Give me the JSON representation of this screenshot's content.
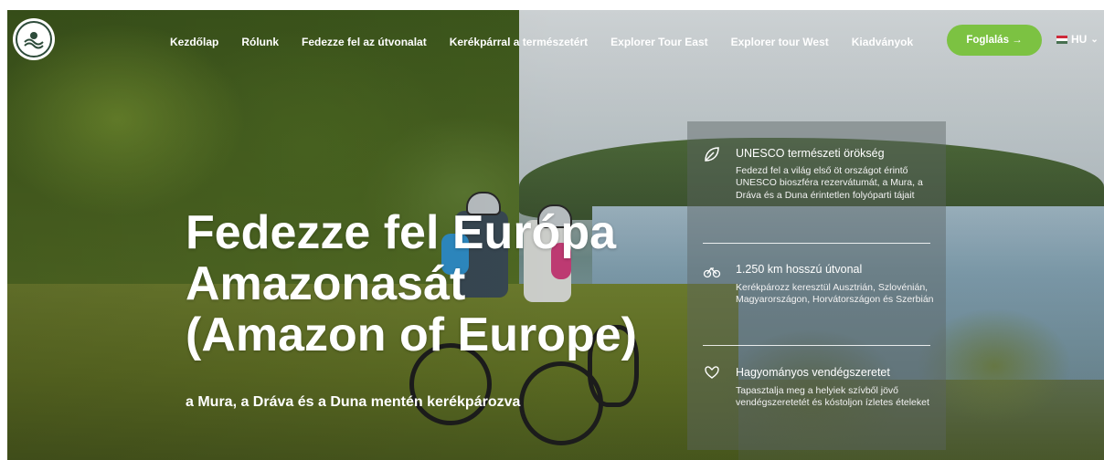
{
  "nav": {
    "logo_label": "",
    "items": [
      {
        "label": "Kezdőlap"
      },
      {
        "label": "Rólunk"
      },
      {
        "label": "Fedezze fel az útvonalat"
      },
      {
        "label": "Kerékpárral a természetért"
      },
      {
        "label": "Explorer Tour East"
      },
      {
        "label": "Explorer tour West"
      },
      {
        "label": "Kiadványok"
      }
    ],
    "cta_label": "Foglalás →",
    "language": "HU",
    "accent_color": "#7cc242"
  },
  "hero": {
    "headline_lines": [
      "Fedezze fel Európa",
      "Amazonasát",
      "(Amazon of Europe)"
    ],
    "subheadline": "a Mura, a Dráva és a Duna mentén kerékpározva"
  },
  "features": [
    {
      "icon": "leaf-icon",
      "title": "UNESCO természeti örökség",
      "description": "Fedezd fel a világ első öt országot érintő UNESCO bioszféra rezervátumát, a Mura, a Dráva és a Duna érintetlen folyóparti tájait"
    },
    {
      "icon": "bicycle-icon",
      "title": "1.250 km hosszú útvonal",
      "description": "Kerékpározz keresztül Ausztrián, Szlovénián, Magyarországon, Horvátországon és Szerbián"
    },
    {
      "icon": "heart-hands-icon",
      "title": "Hagyományos vendégszeretet",
      "description": "Tapasztalja meg a helyiek szívből jövő vendégszeretetét és kóstoljon ízletes ételeket"
    }
  ]
}
